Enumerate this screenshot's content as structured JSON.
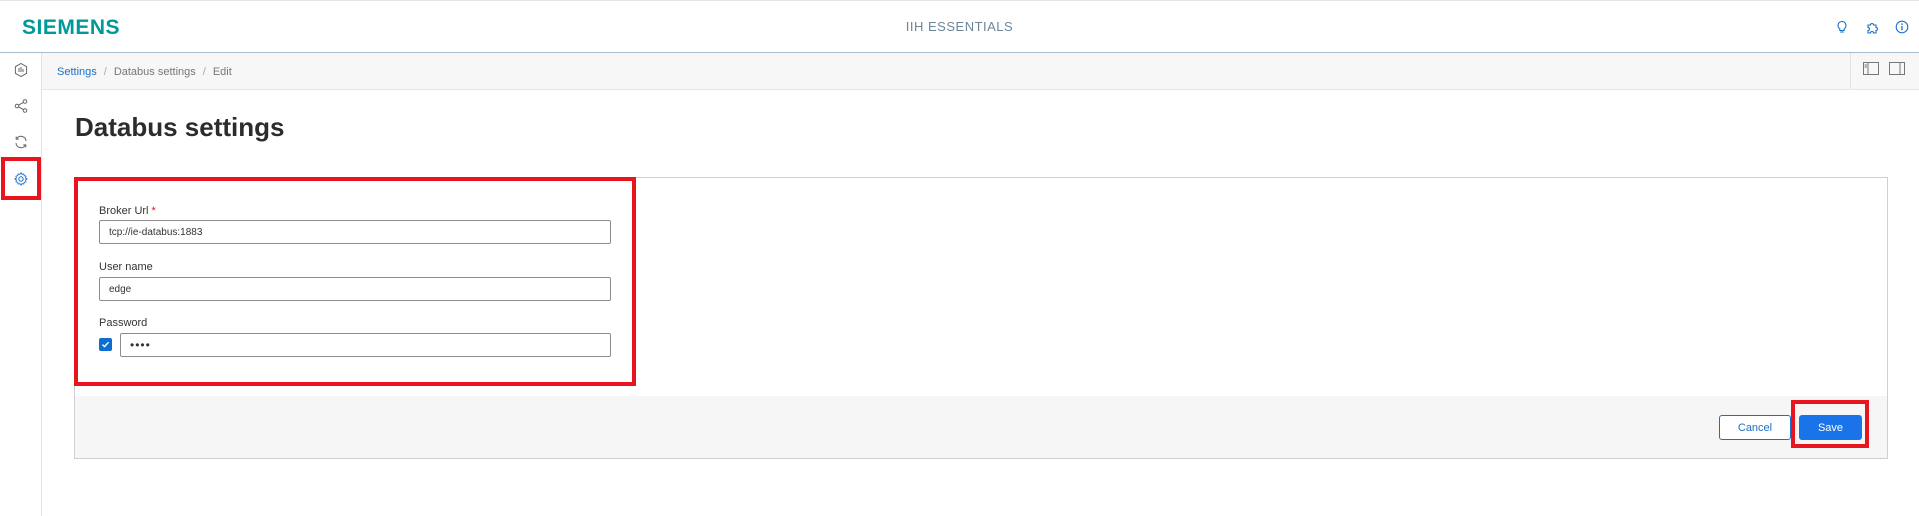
{
  "header": {
    "logo_text": "SIEMENS",
    "app_title": "IIH ESSENTIALS",
    "icons": [
      "lightbulb-icon",
      "puzzle-icon",
      "info-icon"
    ]
  },
  "sidebar": {
    "items": [
      {
        "icon": "hexagon-chart-icon"
      },
      {
        "icon": "share-nodes-icon"
      },
      {
        "icon": "sync-icon"
      },
      {
        "icon": "gear-icon",
        "highlighted": true
      }
    ]
  },
  "breadcrumb": {
    "items": [
      "Settings",
      "Databus settings",
      "Edit"
    ],
    "right_icons": [
      "panel-left-icon",
      "panel-right-icon"
    ]
  },
  "page": {
    "title": "Databus settings"
  },
  "form": {
    "broker_url": {
      "label": "Broker Url",
      "required_marker": "*",
      "value": "tcp://ie-databus:1883"
    },
    "user_name": {
      "label": "User name",
      "value": "edge"
    },
    "password": {
      "label": "Password",
      "value_masked": "••••",
      "checkbox_checked": true
    }
  },
  "footer": {
    "cancel_label": "Cancel",
    "save_label": "Save"
  },
  "colors": {
    "brand": "#009999",
    "accent": "#1a73e8",
    "highlight": "#e8141e"
  }
}
